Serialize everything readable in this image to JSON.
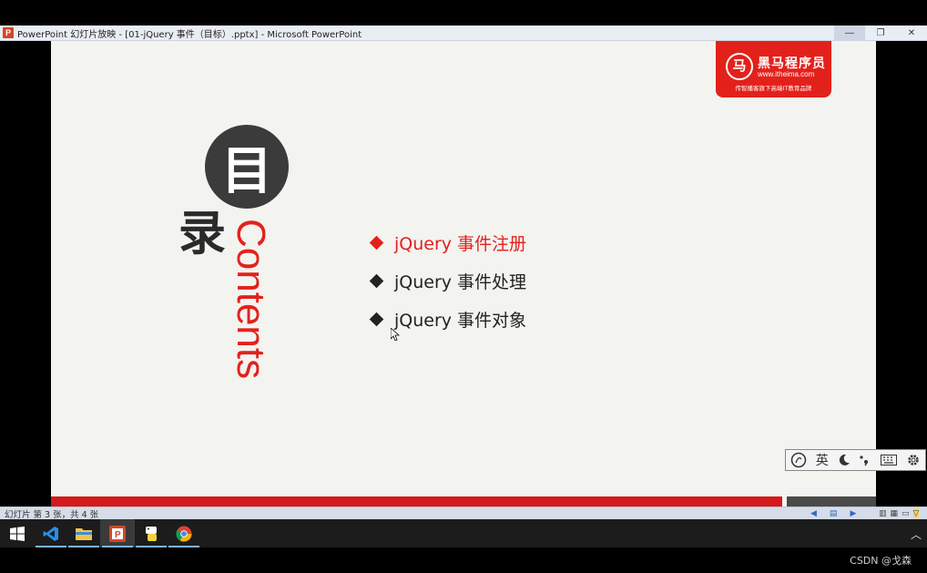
{
  "window": {
    "app_icon": "P",
    "title": "PowerPoint 幻灯片放映 - [01-jQuery 事件（目标）.pptx] - Microsoft PowerPoint",
    "minimize": "—",
    "restore": "❐",
    "close": "✕"
  },
  "slide": {
    "logo": {
      "brand": "黑马程序员",
      "url": "www.itheima.com",
      "slogan": "传智播客旗下高端IT教育品牌",
      "mark": "马"
    },
    "heading_char1": "目",
    "heading_char2": "录",
    "contents_word": "Contents",
    "menu": [
      {
        "label": "jQuery 事件注册",
        "active": true
      },
      {
        "label": "jQuery 事件处理",
        "active": false
      },
      {
        "label": "jQuery 事件对象",
        "active": false
      }
    ],
    "colors": {
      "accent": "#e3211b",
      "dark": "#3b3b3b",
      "background": "#f3f3f0"
    }
  },
  "ime_toolbar": {
    "items": [
      "sogou-icon",
      "英",
      "moon-icon",
      "punctuation-icon",
      "keyboard-icon",
      "gear-icon"
    ],
    "lang_label": "英"
  },
  "statusbar": {
    "slide_info": "幻灯片 第 3 张，共 4 张"
  },
  "taskbar": {
    "apps": [
      "windows-start-icon",
      "vscode-icon",
      "file-explorer-icon",
      "powerpoint-icon",
      "python-icon",
      "chrome-icon"
    ]
  },
  "watermark": "CSDN @戈森"
}
